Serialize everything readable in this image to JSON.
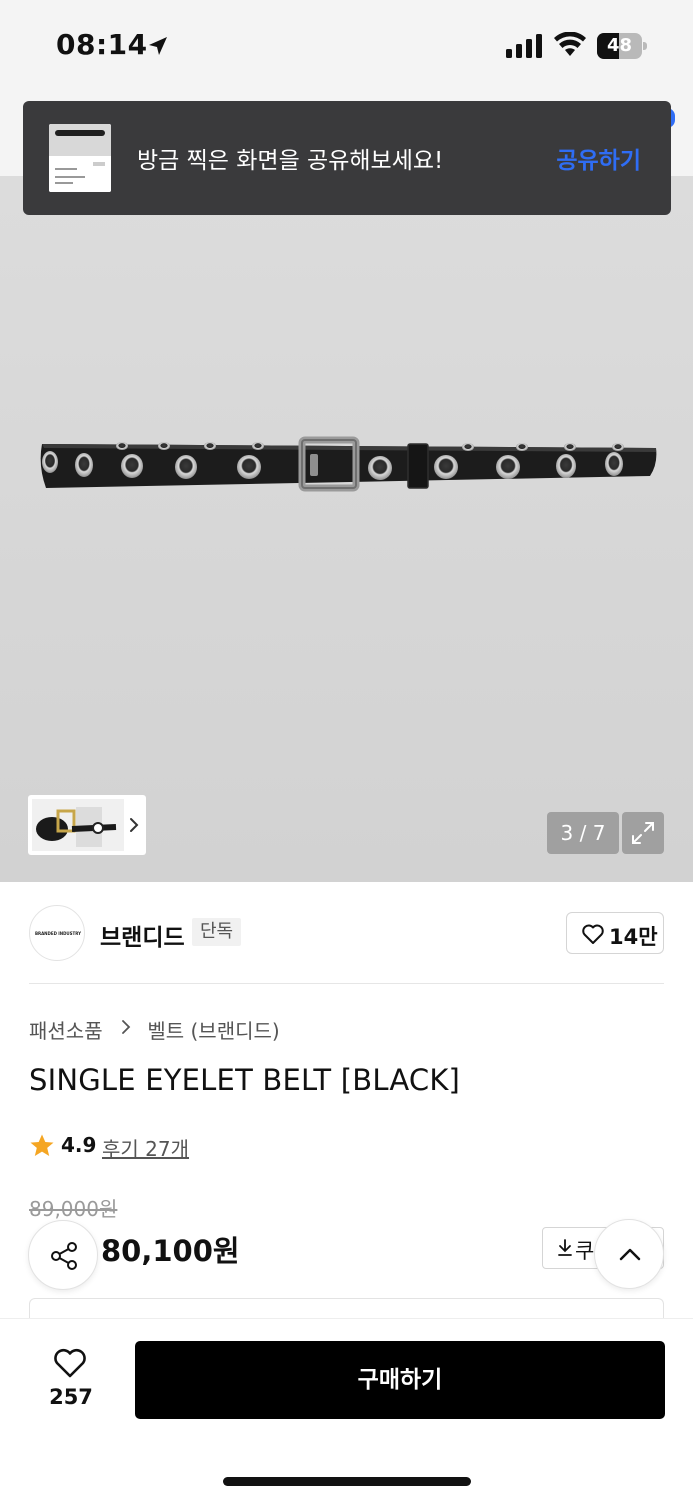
{
  "status_bar": {
    "time": "08:14",
    "battery": "48",
    "battery_level": 0.48
  },
  "toast": {
    "message": "방금 찍은 화면을 공유해보세요!",
    "action_label": "공유하기"
  },
  "gallery": {
    "page_indicator": "3 / 7",
    "current_page": 3,
    "total_pages": 7
  },
  "brand": {
    "name": "브랜디드",
    "badge": "단독",
    "logo_text": "BRANDED INDUSTRY",
    "likes": "14만"
  },
  "product": {
    "breadcrumb": [
      "패션소품",
      "벨트 (브랜디드)"
    ],
    "title": "SINGLE EYELET BELT [BLACK]",
    "rating": "4.9",
    "rating_value": 4.9,
    "review_link": "후기 27개",
    "original_price": "89,000원",
    "sale_price": "80,100원",
    "coupon_label": "쿠"
  },
  "bottom_bar": {
    "wish_count": "257",
    "buy_label": "구매하기"
  },
  "colors": {
    "accent_blue": "#2f6df4",
    "star": "#f5a623",
    "buy_button": "#000000",
    "toast_bg": "#3a3a3c"
  },
  "icons": [
    "location-arrow-icon",
    "cellular-signal-icon",
    "wifi-icon",
    "battery-icon",
    "chevron-right-icon",
    "expand-icon",
    "heart-icon",
    "star-icon",
    "download-icon",
    "share-icon",
    "chevron-up-icon"
  ]
}
